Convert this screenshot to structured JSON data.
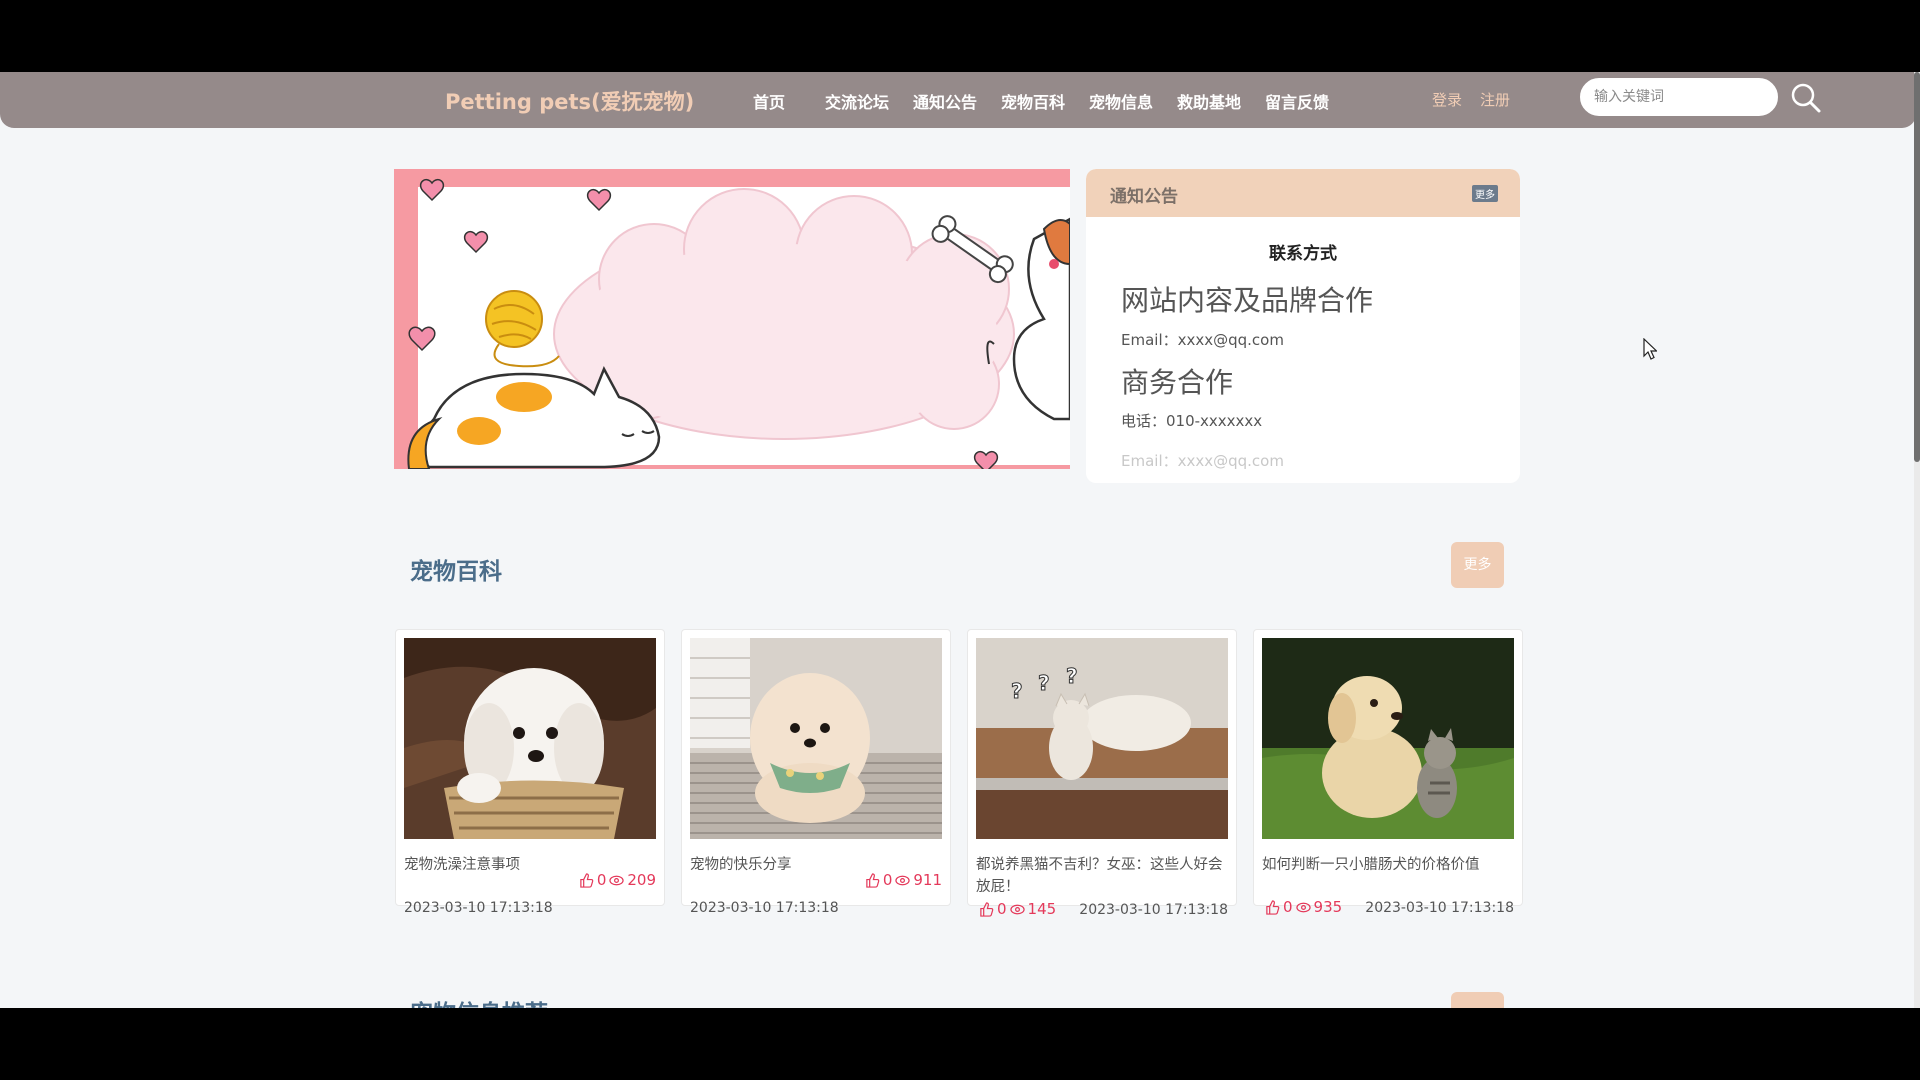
{
  "brand": "Petting pets(爱抚宠物)",
  "nav": [
    "首页",
    "交流论坛",
    "通知公告",
    "宠物百科",
    "宠物信息",
    "救助基地",
    "留言反馈"
  ],
  "auth": {
    "login": "登录",
    "register": "注册"
  },
  "search": {
    "placeholder": "输入关键词",
    "icon": "search-icon"
  },
  "notice": {
    "title": "通知公告",
    "more": "更多",
    "subtitle": "联系方式",
    "blocks": [
      {
        "heading": "网站内容及品牌合作",
        "line": "Email：xxxx@qq.com"
      },
      {
        "heading": "商务合作",
        "line": "电话：010-xxxxxxx",
        "line2": "Email：xxxx@qq.com"
      }
    ]
  },
  "encyclopedia": {
    "title": "宠物百科",
    "more": "更多",
    "cards": [
      {
        "title": "宠物洗澡注意事项",
        "likes": "0",
        "views": "209",
        "date": "2023-03-10 17:13:18"
      },
      {
        "title": "宠物的快乐分享",
        "likes": "0",
        "views": "911",
        "date": "2023-03-10 17:13:18"
      },
      {
        "title": "都说养黑猫不吉利？女巫：这些人好会放屁！",
        "likes": "0",
        "views": "145",
        "date": "2023-03-10 17:13:18"
      },
      {
        "title": "如何判断一只小腊肠犬的价格价值",
        "likes": "0",
        "views": "935",
        "date": "2023-03-10 17:13:18"
      }
    ]
  },
  "next_section": {
    "title": "宠物信息推荐"
  },
  "colors": {
    "navbar": "#958a8a",
    "accent": "#f1cdb5",
    "section_title": "#4b6d8a",
    "stats": "#e4395a"
  }
}
